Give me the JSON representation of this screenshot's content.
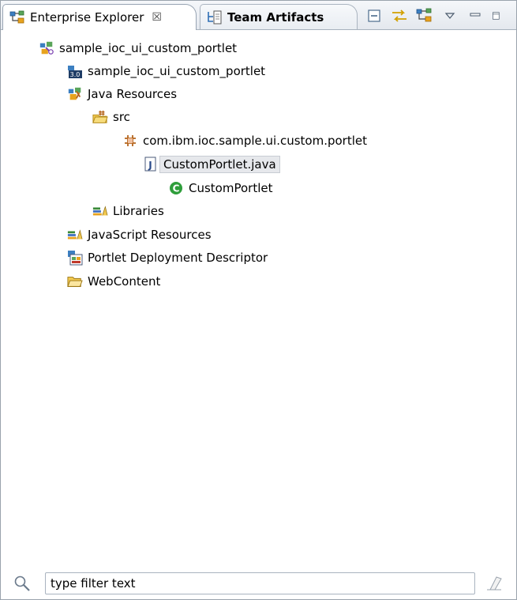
{
  "tabs": [
    {
      "label": "Enterprise Explorer",
      "close": "☒"
    },
    {
      "label": "Team Artifacts"
    }
  ],
  "tree": {
    "project": "sample_ioc_ui_custom_portlet",
    "facet": "sample_ioc_ui_custom_portlet",
    "java_resources": "Java Resources",
    "src": "src",
    "package": "com.ibm.ioc.sample.ui.custom.portlet",
    "java_file": "CustomPortlet.java",
    "class": "CustomPortlet",
    "libraries": "Libraries",
    "js_resources": "JavaScript Resources",
    "portlet_dd": "Portlet Deployment Descriptor",
    "webcontent": "WebContent"
  },
  "filter": {
    "placeholder": "type filter text"
  },
  "colors": {
    "selection": "#e6e8ec",
    "tab_border": "#98a4b3",
    "class_green": "#2f9e3b",
    "package_brown": "#b5651d",
    "folder_yellow": "#f1c850"
  }
}
